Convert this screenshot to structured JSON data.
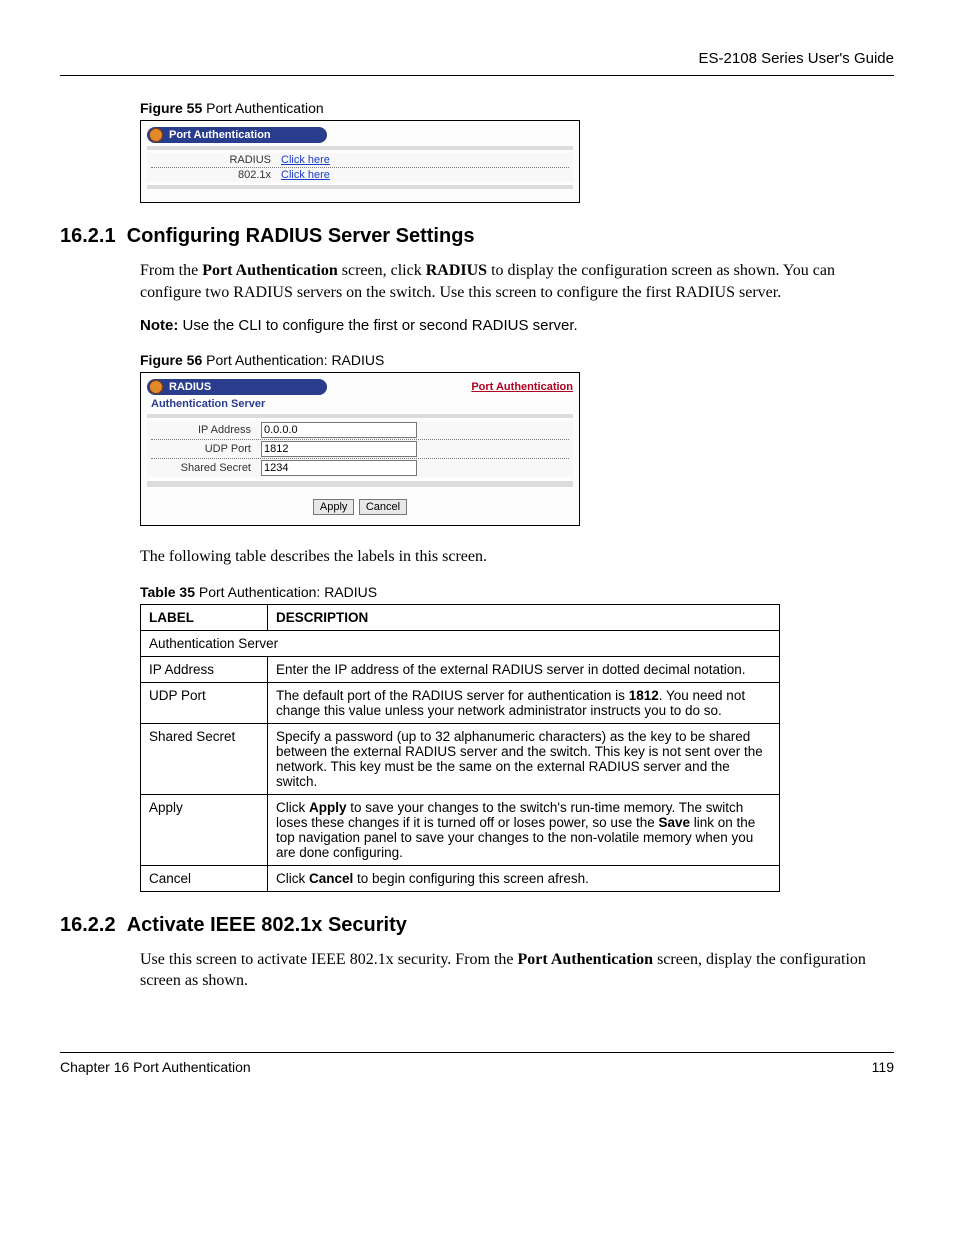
{
  "header": {
    "guide": "ES-2108 Series User's Guide"
  },
  "fig55": {
    "caption_bold": "Figure 55",
    "caption_rest": "   Port Authentication",
    "tab": "Port Authentication",
    "rows": [
      {
        "label": "RADIUS",
        "link": "Click here"
      },
      {
        "label": "802.1x",
        "link": "Click here"
      }
    ]
  },
  "sec1": {
    "num": "16.2.1",
    "title": "Configuring RADIUS Server Settings",
    "p1_a": "From the ",
    "p1_b": "Port Authentication",
    "p1_c": " screen, click ",
    "p1_d": "RADIUS",
    "p1_e": " to display the configuration screen as shown. You can configure two RADIUS servers on the switch. Use this screen to configure the first RADIUS server.",
    "note_b": "Note:",
    "note_t": " Use the CLI to configure the first or second RADIUS server."
  },
  "fig56": {
    "caption_bold": "Figure 56",
    "caption_rest": "   Port Authentication: RADIUS",
    "tab": "RADIUS",
    "top_link": "Port Authentication",
    "sub": "Authentication Server",
    "rows": {
      "ip_lbl": "IP Address",
      "ip_val": "0.0.0.0",
      "port_lbl": "UDP Port",
      "port_val": "1812",
      "secret_lbl": "Shared Secret",
      "secret_val": "1234"
    },
    "apply": "Apply",
    "cancel": "Cancel"
  },
  "after_fig": "The following table describes the labels in this screen.",
  "table35": {
    "caption_bold": "Table 35",
    "caption_rest": "   Port Authentication: RADIUS",
    "h1": "LABEL",
    "h2": "DESCRIPTION",
    "span": "Authentication Server",
    "rows": [
      {
        "l": "IP Address",
        "d": "Enter the IP address of the external RADIUS server in dotted decimal notation."
      },
      {
        "l": "UDP Port",
        "d_a": "The default port of the RADIUS server for authentication is ",
        "d_b": "1812",
        "d_c": ". You need not change this value unless your network administrator instructs you to do so."
      },
      {
        "l": "Shared Secret",
        "d": "Specify a password (up to 32 alphanumeric characters) as the key to be shared between the external RADIUS server and the switch. This key is not sent over the network. This key must be the same on the external RADIUS server and the switch."
      },
      {
        "l": "Apply",
        "d_a": "Click ",
        "d_b": "Apply",
        "d_c": " to save your changes to the switch's run-time memory. The switch loses these changes if it is turned off or loses power, so use the ",
        "d_d": "Save",
        "d_e": " link on the top navigation panel to save your changes to the non-volatile memory when you are done configuring."
      },
      {
        "l": "Cancel",
        "d_a": "Click ",
        "d_b": "Cancel",
        "d_c": " to begin configuring this screen afresh."
      }
    ]
  },
  "sec2": {
    "num": "16.2.2",
    "title": "Activate IEEE 802.1x Security",
    "p_a": "Use this screen to activate IEEE 802.1x security. From the ",
    "p_b": "Port Authentication",
    "p_c": " screen, display the configuration screen as shown."
  },
  "footer": {
    "chapter": "Chapter 16 Port Authentication",
    "page": "119"
  }
}
